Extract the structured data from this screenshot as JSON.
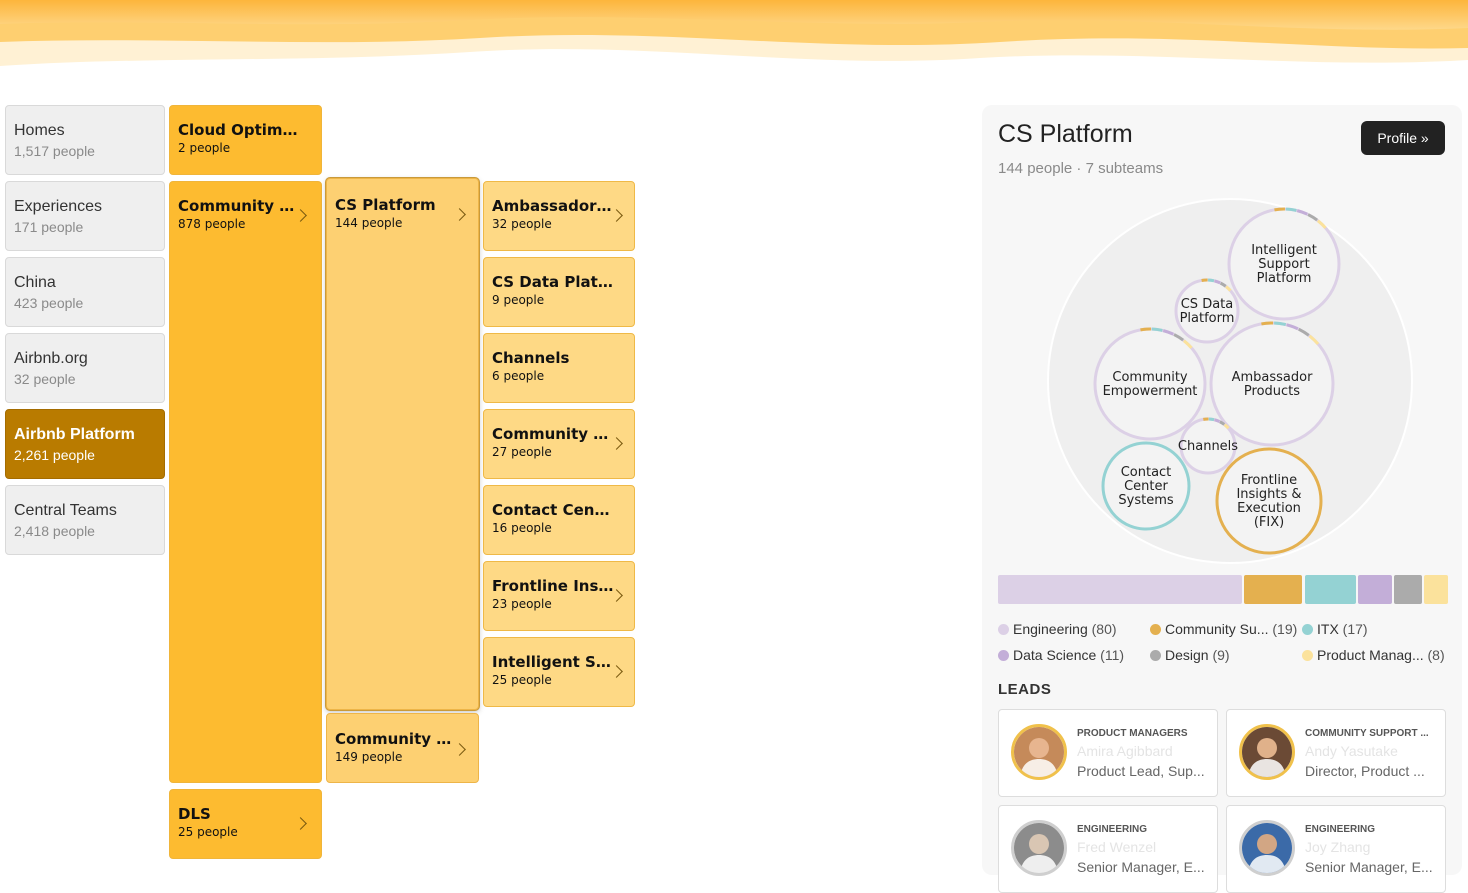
{
  "divisions": [
    {
      "name": "Homes",
      "count": "1,517 people"
    },
    {
      "name": "Experiences",
      "count": "171 people"
    },
    {
      "name": "China",
      "count": "423 people"
    },
    {
      "name": "Airbnb.org",
      "count": "32 people"
    },
    {
      "name": "Airbnb Platform",
      "count": "2,261 people",
      "active": true
    },
    {
      "name": "Central Teams",
      "count": "2,418 people"
    }
  ],
  "groups": [
    {
      "name": "Cloud Optimization",
      "count": "2 people"
    },
    {
      "name": "Community Support",
      "count": "878 people"
    },
    {
      "name": "DLS",
      "count": "25 people"
    }
  ],
  "subgroups": [
    {
      "name": "CS Platform",
      "count": "144 people"
    },
    {
      "name": "Community Support",
      "count": "149 people"
    }
  ],
  "teams": [
    {
      "name": "Ambassador Products",
      "count": "32 people"
    },
    {
      "name": "CS Data Platform",
      "count": "9 people"
    },
    {
      "name": "Channels",
      "count": "6 people"
    },
    {
      "name": "Community Empowerment",
      "count": "27 people"
    },
    {
      "name": "Contact Center Systems",
      "count": "16 people"
    },
    {
      "name": "Frontline Insights & Execution (FIX)",
      "count": "23 people"
    },
    {
      "name": "Intelligent Support Platform",
      "count": "25 people"
    }
  ],
  "panel": {
    "title": "CS Platform",
    "subtitle": "144 people · 7 subteams",
    "profile_button": "Profile »",
    "bubbles": [
      {
        "lines": [
          "Intelligent",
          "Support",
          "Platform"
        ]
      },
      {
        "lines": [
          "CS Data",
          "Platform"
        ]
      },
      {
        "lines": [
          "Community",
          "Empowerment"
        ]
      },
      {
        "lines": [
          "Ambassador",
          "Products"
        ]
      },
      {
        "lines": [
          "Channels"
        ]
      },
      {
        "lines": [
          "Contact",
          "Center",
          "Systems"
        ]
      },
      {
        "lines": [
          "Frontline",
          "Insights &",
          "Execution",
          "(FIX)"
        ]
      }
    ],
    "legend": [
      {
        "label": "Engineering",
        "count": "(80)",
        "value": 80,
        "color": "#dcd0e6"
      },
      {
        "label": "Community Su...",
        "count": "(19)",
        "value": 19,
        "color": "#e4b04f"
      },
      {
        "label": "ITX",
        "count": "(17)",
        "value": 17,
        "color": "#94d2d3"
      },
      {
        "label": "Data Science",
        "count": "(11)",
        "value": 11,
        "color": "#c3aed8"
      },
      {
        "label": "Design",
        "count": "(9)",
        "value": 9,
        "color": "#ababab"
      },
      {
        "label": "Product Manag...",
        "count": "(8)",
        "value": 8,
        "color": "#fbe29c"
      }
    ],
    "leads_heading": "LEADS",
    "leads": [
      {
        "role": "PRODUCT MANAGERS",
        "name": "Amira Agibbard",
        "title": "Product Lead, Sup..."
      },
      {
        "role": "COMMUNITY SUPPORT ...",
        "name": "Andy Yasutake",
        "title": "Director, Product ..."
      },
      {
        "role": "ENGINEERING",
        "name": "Fred Wenzel",
        "title": "Senior Manager, E..."
      },
      {
        "role": "ENGINEERING",
        "name": "Joy Zhang",
        "title": "Senior Manager, E..."
      }
    ]
  }
}
